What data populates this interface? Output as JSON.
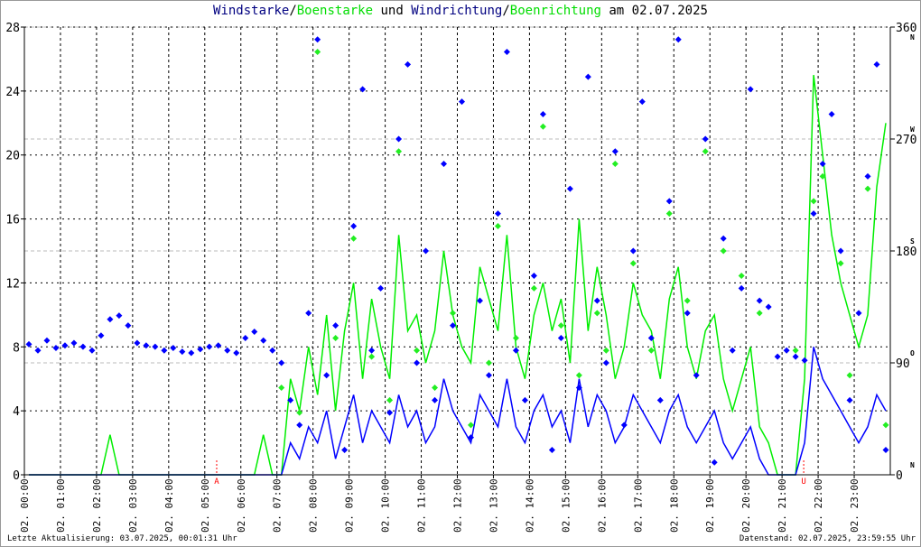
{
  "title": {
    "part1": "Windstarke",
    "sep1": "/",
    "part2": "Boenstarke",
    "part3": " und ",
    "part4": "Windrichtung",
    "sep2": "/",
    "part5": "Boenrichtung",
    "part6": " am 02.07.2025"
  },
  "footer": {
    "last_update": "Letzte Aktualisierung: 03.07.2025, 00:01:31 Uhr",
    "data_status": "Datenstand: 02.07.2025, 23:59:55 Uhr"
  },
  "colors": {
    "speed": "#0000ff",
    "gust": "#00ee00",
    "marker": "#ff0000",
    "grid": "#000000",
    "grid_dir": "#bbbbbb"
  },
  "chart_data": {
    "type": "line+scatter",
    "title": "Windstarke/Boenstarke und Windrichtung/Boenrichtung am 02.07.2025",
    "y_left": {
      "label": "Windstarke",
      "ylim": [
        0,
        28
      ],
      "ticks": [
        "0",
        "4",
        "8",
        "12",
        "16",
        "20",
        "24",
        "28"
      ]
    },
    "y_right": {
      "label": "Richtung",
      "ylim": [
        0,
        360
      ],
      "ticks": [
        "0",
        "90",
        "180",
        "270",
        "360"
      ],
      "compass": [
        "N",
        "O",
        "S",
        "W",
        "N"
      ]
    },
    "x_ticks": [
      "02. 00:00",
      "02. 01:00",
      "02. 02:00",
      "02. 03:00",
      "02. 04:00",
      "02. 05:00",
      "02. 06:00",
      "02. 07:00",
      "02. 08:00",
      "02. 09:00",
      "02. 10:00",
      "02. 11:00",
      "02. 12:00",
      "02. 13:00",
      "02. 14:00",
      "02. 15:00",
      "02. 16:00",
      "02. 17:00",
      "02. 18:00",
      "02. 19:00",
      "02. 20:00",
      "02. 21:00",
      "02. 22:00",
      "02. 23:00"
    ],
    "x_range_hours": [
      0,
      24
    ],
    "sample_interval_minutes": 15,
    "markers": [
      {
        "label": "A",
        "hour": 5.33
      },
      {
        "label": "U",
        "hour": 21.6
      }
    ],
    "series": [
      {
        "name": "Boenstarke",
        "kind": "line",
        "axis": "left",
        "values": [
          0,
          0,
          0,
          0,
          0,
          0,
          0,
          0,
          0,
          2.5,
          0,
          0,
          0,
          0,
          0,
          0,
          0,
          0,
          0,
          0,
          0,
          0,
          0,
          0,
          0,
          0,
          2.5,
          0,
          0,
          6,
          4,
          8,
          5,
          10,
          4,
          9,
          12,
          6,
          11,
          8,
          6,
          15,
          9,
          10,
          7,
          9,
          14,
          10,
          8,
          7,
          13,
          11,
          9,
          15,
          8,
          6,
          10,
          12,
          9,
          11,
          7,
          16,
          9,
          13,
          10,
          6,
          8,
          12,
          10,
          9,
          6,
          11,
          13,
          8,
          6,
          9,
          10,
          6,
          4,
          6,
          8,
          3,
          2,
          0,
          0,
          0,
          6,
          25,
          20,
          15,
          12,
          10,
          8,
          10,
          18,
          22
        ]
      },
      {
        "name": "Windstarke",
        "kind": "line",
        "axis": "left",
        "values": [
          0,
          0,
          0,
          0,
          0,
          0,
          0,
          0,
          0,
          0,
          0,
          0,
          0,
          0,
          0,
          0,
          0,
          0,
          0,
          0,
          0,
          0,
          0,
          0,
          0,
          0,
          0,
          0,
          0,
          2,
          1,
          3,
          2,
          4,
          1,
          3,
          5,
          2,
          4,
          3,
          2,
          5,
          3,
          4,
          2,
          3,
          6,
          4,
          3,
          2,
          5,
          4,
          3,
          6,
          3,
          2,
          4,
          5,
          3,
          4,
          2,
          6,
          3,
          5,
          4,
          2,
          3,
          5,
          4,
          3,
          2,
          4,
          5,
          3,
          2,
          3,
          4,
          2,
          1,
          2,
          3,
          1,
          0,
          0,
          0,
          0,
          2,
          8,
          6,
          5,
          4,
          3,
          2,
          3,
          5,
          4
        ]
      },
      {
        "name": "Windrichtung",
        "kind": "scatter",
        "axis": "right",
        "values": [
          105,
          100,
          108,
          102,
          104,
          106,
          103,
          100,
          112,
          125,
          128,
          120,
          106,
          104,
          103,
          100,
          102,
          99,
          98,
          101,
          103,
          104,
          100,
          98,
          110,
          115,
          108,
          100,
          90,
          60,
          40,
          130,
          350,
          80,
          120,
          20,
          200,
          310,
          100,
          150,
          50,
          270,
          330,
          90,
          180,
          60,
          250,
          120,
          300,
          30,
          140,
          80,
          210,
          340,
          100,
          60,
          160,
          290,
          20,
          110,
          230,
          70,
          320,
          140,
          90,
          260,
          40,
          180,
          300,
          110,
          60,
          220,
          350,
          130,
          80,
          270,
          10,
          190,
          100,
          150,
          310,
          140,
          135,
          95,
          100,
          95,
          92,
          210,
          250,
          290,
          180,
          60,
          130,
          240,
          330,
          20
        ]
      },
      {
        "name": "Boenrichtung",
        "kind": "scatter",
        "axis": "right",
        "values": [
          null,
          null,
          null,
          null,
          null,
          null,
          null,
          null,
          null,
          null,
          null,
          null,
          null,
          null,
          null,
          null,
          null,
          null,
          null,
          null,
          null,
          null,
          null,
          null,
          null,
          null,
          null,
          null,
          70,
          null,
          50,
          null,
          340,
          null,
          110,
          null,
          190,
          null,
          95,
          null,
          60,
          260,
          null,
          100,
          null,
          70,
          null,
          130,
          null,
          40,
          null,
          90,
          200,
          null,
          110,
          null,
          150,
          280,
          null,
          120,
          null,
          80,
          null,
          130,
          100,
          250,
          null,
          170,
          null,
          100,
          null,
          210,
          null,
          140,
          null,
          260,
          null,
          180,
          null,
          160,
          null,
          130,
          null,
          null,
          null,
          100,
          null,
          220,
          240,
          null,
          170,
          80,
          null,
          230,
          null,
          40
        ]
      }
    ]
  }
}
